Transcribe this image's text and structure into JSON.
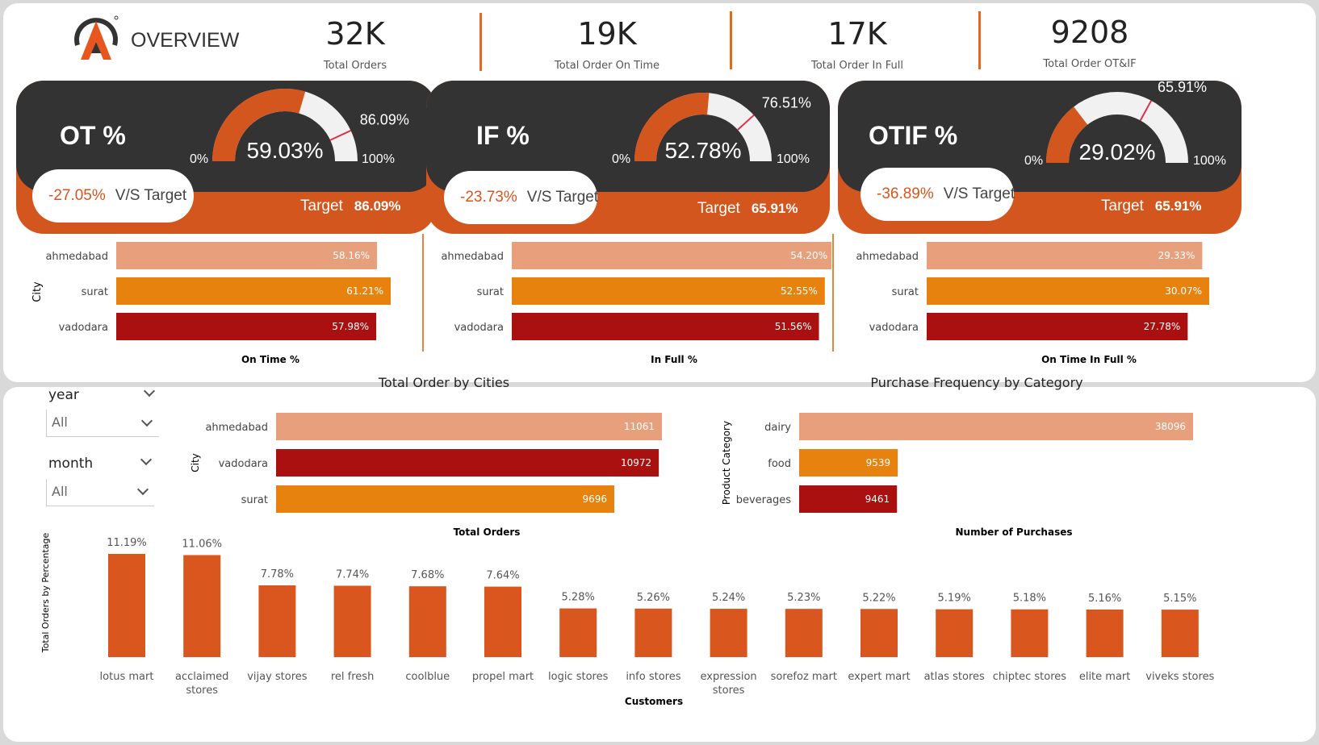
{
  "header": {
    "title": "OVERVIEW",
    "kpis": [
      {
        "value": "32K",
        "label": "Total Orders"
      },
      {
        "value": "19K",
        "label": "Total Order On Time"
      },
      {
        "value": "17K",
        "label": "Total Order In Full"
      },
      {
        "value": "9208",
        "label": "Total Order OT&IF"
      }
    ]
  },
  "cards": [
    {
      "title": "OT %",
      "gauge_value": "59.03%",
      "gauge_fraction": 0.5903,
      "target_fraction": 0.8609,
      "target_label": "86.09%",
      "min_label": "0%",
      "max_label": "100%",
      "delta": "-27.05%",
      "vs_label": "V/S Target",
      "target_text": "Target",
      "target_value": "86.09%"
    },
    {
      "title": "IF %",
      "gauge_value": "52.78%",
      "gauge_fraction": 0.5278,
      "target_fraction": 0.7651,
      "target_label": "76.51%",
      "min_label": "0%",
      "max_label": "100%",
      "delta": "-23.73%",
      "vs_label": "V/S Target",
      "target_text": "Target",
      "target_value": "65.91%"
    },
    {
      "title": "OTIF %",
      "gauge_value": "29.02%",
      "gauge_fraction": 0.2902,
      "target_fraction": 0.6591,
      "target_label": "65.91%",
      "min_label": "0%",
      "max_label": "100%",
      "delta": "-36.89%",
      "vs_label": "V/S Target",
      "target_text": "Target",
      "target_value": "65.91%"
    }
  ],
  "colors": {
    "accent": "#d4561f",
    "dark": "#333333",
    "ahmedabad": "#e8a07c",
    "surat": "#e8820f",
    "vadodara": "#ab1010",
    "customer_bar": "#d9561f"
  },
  "filters": {
    "year_label": "year",
    "year_value": "All",
    "month_label": "month",
    "month_value": "All"
  },
  "chart_data": [
    {
      "type": "bar",
      "orientation": "horizontal",
      "xlabel": "On Time %",
      "ylabel": "City",
      "categories": [
        "ahmedabad",
        "surat",
        "vadodara"
      ],
      "values": [
        58.16,
        61.21,
        57.98
      ],
      "labels": [
        "58.16%",
        "61.21%",
        "57.98%"
      ]
    },
    {
      "type": "bar",
      "orientation": "horizontal",
      "xlabel": "In Full %",
      "ylabel": "",
      "categories": [
        "ahmedabad",
        "surat",
        "vadodara"
      ],
      "values": [
        54.2,
        52.55,
        51.56
      ],
      "labels": [
        "54.20%",
        "52.55%",
        "51.56%"
      ]
    },
    {
      "type": "bar",
      "orientation": "horizontal",
      "xlabel": "On Time In Full %",
      "ylabel": "",
      "categories": [
        "ahmedabad",
        "surat",
        "vadodara"
      ],
      "values": [
        29.33,
        30.07,
        27.78
      ],
      "labels": [
        "29.33%",
        "30.07%",
        "27.78%"
      ]
    },
    {
      "type": "bar",
      "orientation": "horizontal",
      "title": "Total Order by Cities",
      "xlabel": "Total Orders",
      "ylabel": "City",
      "categories": [
        "ahmedabad",
        "vadodara",
        "surat"
      ],
      "values": [
        11061,
        10972,
        9696
      ],
      "labels": [
        "11061",
        "10972",
        "9696"
      ]
    },
    {
      "type": "bar",
      "orientation": "horizontal",
      "title": "Purchase Frequency by Category",
      "xlabel": "Number of Purchases",
      "ylabel": "Product Category",
      "categories": [
        "dairy",
        "food",
        "beverages"
      ],
      "values": [
        38096,
        9539,
        9461
      ],
      "labels": [
        "38096",
        "9539",
        "9461"
      ]
    },
    {
      "type": "bar",
      "orientation": "vertical",
      "xlabel": "Customers",
      "ylabel": "Total Orders by Percentage",
      "categories": [
        "lotus mart",
        "acclaimed stores",
        "vijay stores",
        "rel fresh",
        "coolblue",
        "propel mart",
        "logic stores",
        "info stores",
        "expression stores",
        "sorefoz mart",
        "expert mart",
        "atlas stores",
        "chiptec stores",
        "elite mart",
        "viveks stores"
      ],
      "values": [
        11.19,
        11.06,
        7.78,
        7.74,
        7.68,
        7.64,
        5.28,
        5.26,
        5.24,
        5.23,
        5.22,
        5.19,
        5.18,
        5.16,
        5.15
      ],
      "labels": [
        "11.19%",
        "11.06%",
        "7.78%",
        "7.74%",
        "7.68%",
        "7.64%",
        "5.28%",
        "5.26%",
        "5.24%",
        "5.23%",
        "5.22%",
        "5.19%",
        "5.18%",
        "5.16%",
        "5.15%"
      ]
    }
  ]
}
